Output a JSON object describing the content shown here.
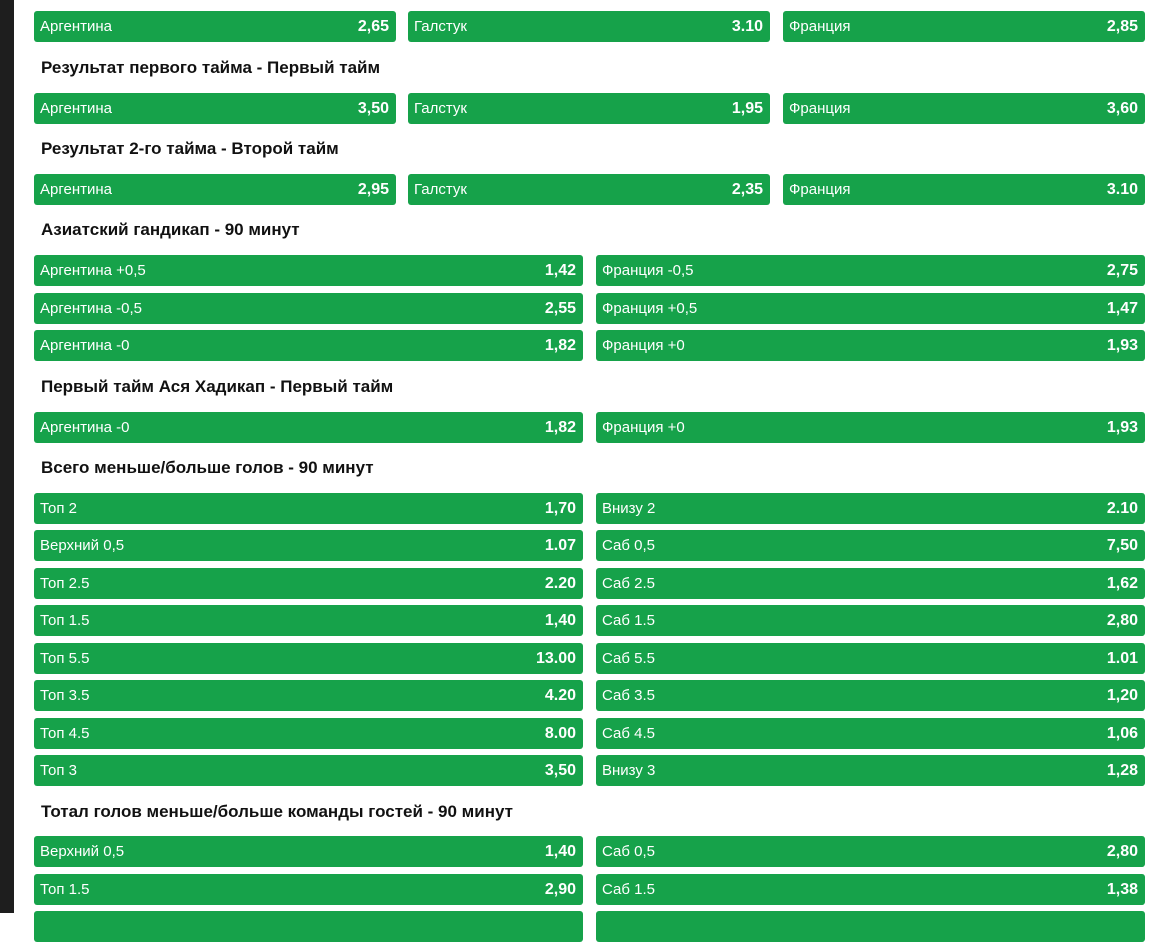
{
  "colors": {
    "button_bg": "#16a24a",
    "button_text": "#ffffff",
    "heading_text": "#111111",
    "left_bar": "#1e1e1e"
  },
  "sections": [
    {
      "title": "",
      "rows": [
        [
          {
            "label": "Аргентина",
            "odds": "2,65"
          },
          {
            "label": "Галстук",
            "odds": "3.10"
          },
          {
            "label": "Франция",
            "odds": "2,85"
          }
        ]
      ]
    },
    {
      "title": "Результат первого тайма - Первый тайм",
      "rows": [
        [
          {
            "label": "Аргентина",
            "odds": "3,50"
          },
          {
            "label": "Галстук",
            "odds": "1,95"
          },
          {
            "label": "Франция",
            "odds": "3,60"
          }
        ]
      ]
    },
    {
      "title": "Результат 2-го тайма - Второй тайм",
      "rows": [
        [
          {
            "label": "Аргентина",
            "odds": "2,95"
          },
          {
            "label": "Галстук",
            "odds": "2,35"
          },
          {
            "label": "Франция",
            "odds": "3.10"
          }
        ]
      ]
    },
    {
      "title": "Азиатский гандикап - 90 минут",
      "rows": [
        [
          {
            "label": "Аргентина  +0,5",
            "odds": "1,42"
          },
          {
            "label": "Франция  -0,5",
            "odds": "2,75"
          }
        ],
        [
          {
            "label": "Аргентина  -0,5",
            "odds": "2,55"
          },
          {
            "label": "Франция  +0,5",
            "odds": "1,47"
          }
        ],
        [
          {
            "label": "Аргентина  -0",
            "odds": "1,82"
          },
          {
            "label": "Франция  +0",
            "odds": "1,93"
          }
        ]
      ]
    },
    {
      "title": "Первый тайм Ася Хадикап - Первый тайм",
      "rows": [
        [
          {
            "label": "Аргентина  -0",
            "odds": "1,82"
          },
          {
            "label": "Франция  +0",
            "odds": "1,93"
          }
        ]
      ]
    },
    {
      "title": "Всего меньше/больше голов - 90 минут",
      "rows": [
        [
          {
            "label": "Топ 2",
            "odds": "1,70"
          },
          {
            "label": "Внизу 2",
            "odds": "2.10"
          }
        ],
        [
          {
            "label": "Верхний 0,5",
            "odds": "1.07"
          },
          {
            "label": "Саб 0,5",
            "odds": "7,50"
          }
        ],
        [
          {
            "label": "Топ 2.5",
            "odds": "2.20"
          },
          {
            "label": "Саб 2.5",
            "odds": "1,62"
          }
        ],
        [
          {
            "label": "Топ 1.5",
            "odds": "1,40"
          },
          {
            "label": "Саб 1.5",
            "odds": "2,80"
          }
        ],
        [
          {
            "label": "Топ 5.5",
            "odds": "13.00"
          },
          {
            "label": "Саб 5.5",
            "odds": "1.01"
          }
        ],
        [
          {
            "label": "Топ 3.5",
            "odds": "4.20"
          },
          {
            "label": "Саб 3.5",
            "odds": "1,20"
          }
        ],
        [
          {
            "label": "Топ 4.5",
            "odds": "8.00"
          },
          {
            "label": "Саб 4.5",
            "odds": "1,06"
          }
        ],
        [
          {
            "label": "Топ 3",
            "odds": "3,50"
          },
          {
            "label": "Внизу 3",
            "odds": "1,28"
          }
        ]
      ]
    },
    {
      "title": "Тотал голов меньше/больше команды гостей - 90 минут",
      "rows": [
        [
          {
            "label": "Верхний 0,5",
            "odds": "1,40"
          },
          {
            "label": "Саб 0,5",
            "odds": "2,80"
          }
        ],
        [
          {
            "label": "Топ 1.5",
            "odds": "2,90"
          },
          {
            "label": "Саб 1.5",
            "odds": "1,38"
          }
        ],
        [
          {
            "label": "",
            "odds": ""
          },
          {
            "label": "",
            "odds": ""
          }
        ]
      ]
    }
  ]
}
